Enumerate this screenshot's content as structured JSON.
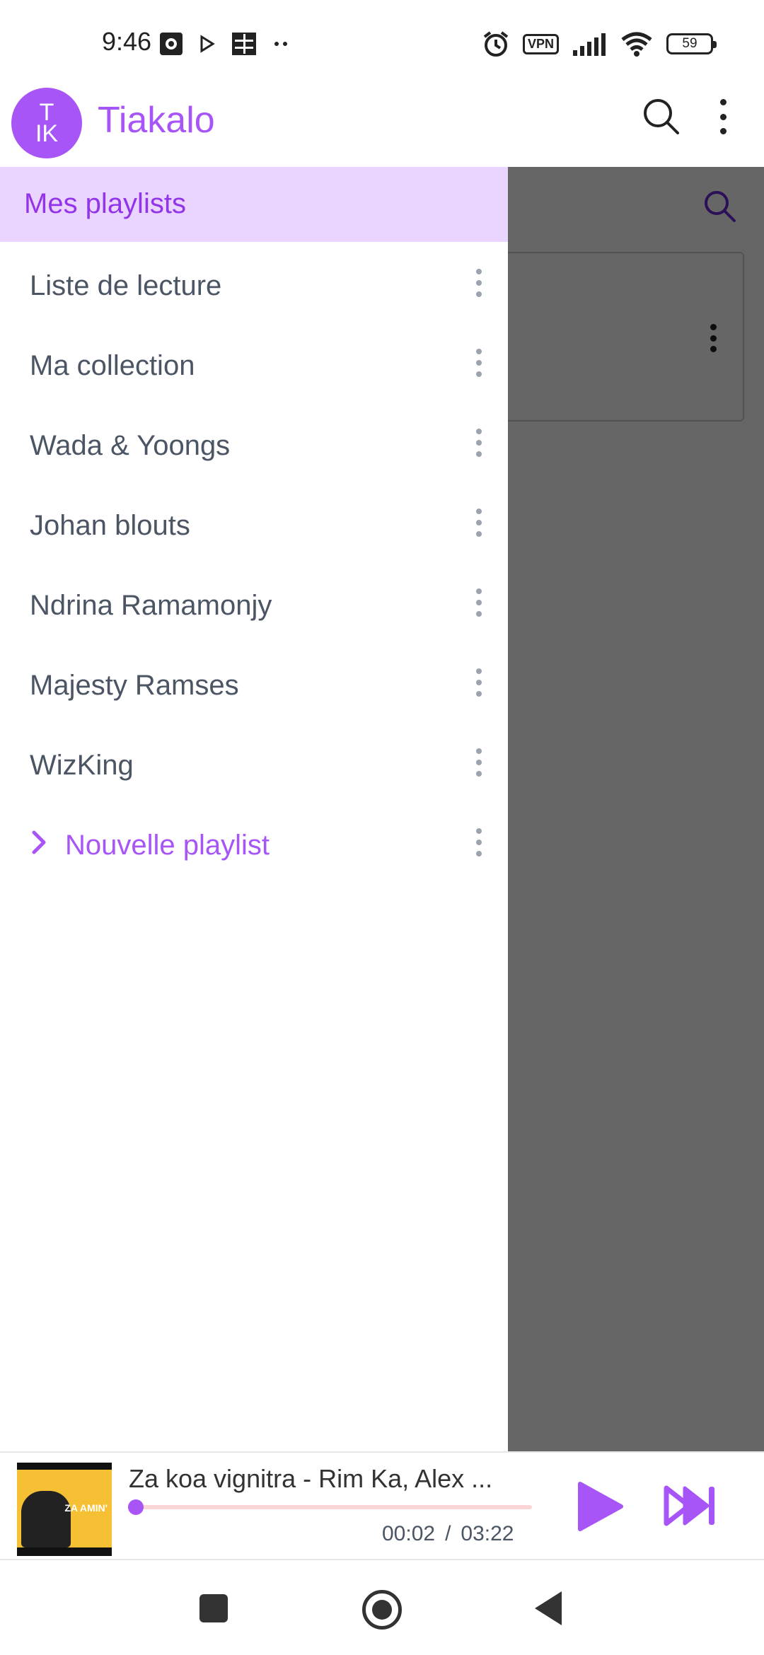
{
  "status_bar": {
    "time": "9:46",
    "vpn": "VPN",
    "battery": "59"
  },
  "app_bar": {
    "logo_text_top": "T",
    "logo_text_bottom": "IK",
    "title": "Tiakalo"
  },
  "drawer": {
    "header_title": "Mes playlists",
    "playlists": [
      {
        "label": "Liste de lecture"
      },
      {
        "label": "Ma collection"
      },
      {
        "label": "Wada & Yoongs"
      },
      {
        "label": "Johan blouts"
      },
      {
        "label": "Ndrina Ramamonjy"
      },
      {
        "label": "Majesty Ramses"
      },
      {
        "label": "WizKing"
      }
    ],
    "new_playlist_label": "Nouvelle playlist"
  },
  "player": {
    "title": "Za koa vignitra - Rim Ka, Alex ...",
    "current_time": "00:02",
    "separator": "/",
    "duration": "03:22",
    "progress": 0.01,
    "cover_text": "ZA AMIN'"
  },
  "colors": {
    "accent": "#a855f7",
    "drawer_header_bg": "#e9d5ff",
    "scrim": "#000000"
  }
}
